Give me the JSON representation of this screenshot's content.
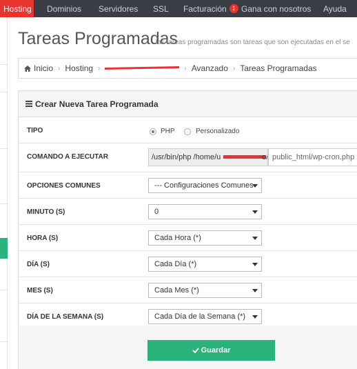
{
  "topnav": {
    "items": [
      {
        "label": "Hosting",
        "active": true
      },
      {
        "label": "Dominios"
      },
      {
        "label": "Servidores"
      },
      {
        "label": "SSL"
      },
      {
        "label": "Facturación",
        "badge": "1"
      },
      {
        "label": "Gana con nosotros"
      },
      {
        "label": "Ayuda"
      }
    ]
  },
  "header": {
    "title": "Tareas Programadas",
    "subtitle": "las tareas programadas son tareas que son ejecutadas en el se"
  },
  "breadcrumb": {
    "home": "Inicio",
    "items": [
      "Hosting",
      "Avanzado",
      "Tareas Programadas"
    ]
  },
  "panel": {
    "title": "Crear Nueva Tarea Programada",
    "fields": {
      "tipo": {
        "label": "TIPO",
        "options": [
          "PHP",
          "Personalizado"
        ],
        "selected": "PHP"
      },
      "comando": {
        "label": "COMANDO A EJECUTAR",
        "prefix": "/usr/bin/php /home/u",
        "prefix_tail": "o/",
        "value": "public_html/wp-cron.php"
      },
      "opciones": {
        "label": "OPCIONES COMUNES",
        "value": "--- Configuraciones Comunes"
      },
      "minuto": {
        "label": "MINUTO (S)",
        "value": "0"
      },
      "hora": {
        "label": "HORA (S)",
        "value": "Cada Hora (*)"
      },
      "dia": {
        "label": "DÍA (S)",
        "value": "Cada Día (*)"
      },
      "mes": {
        "label": "MES (S)",
        "value": "Cada Mes (*)"
      },
      "dia_semana": {
        "label": "DÍA DE LA SEMANA (S)",
        "value": "Cada Día de la Semana (*)"
      }
    },
    "save_label": "Guardar"
  },
  "colors": {
    "accent": "#e8332f",
    "nav_bg": "#3a3d45",
    "success": "#2ab27b"
  }
}
